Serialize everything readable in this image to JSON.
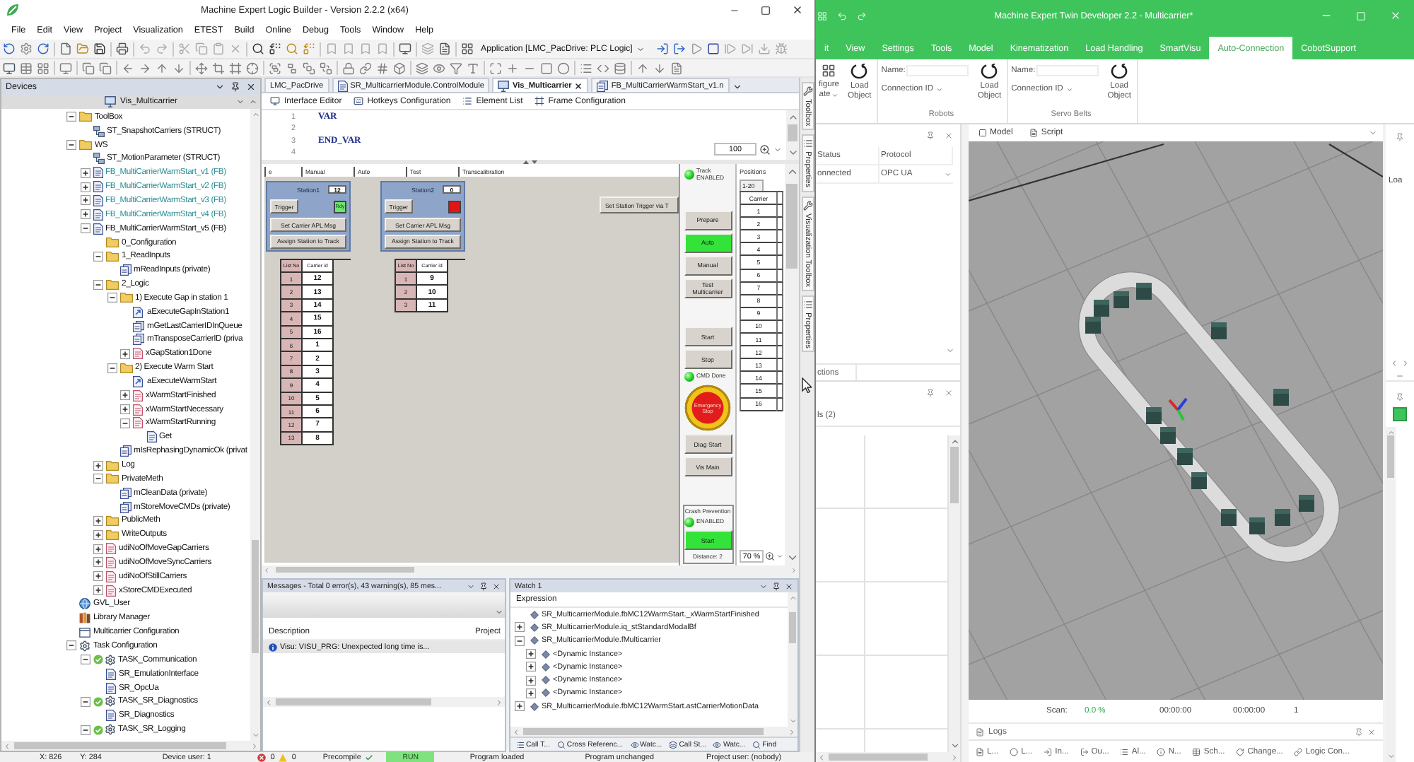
{
  "logic_builder": {
    "title": "Machine Expert Logic Builder - Version 2.2.2 (x64)",
    "menu": [
      "File",
      "Edit",
      "View",
      "Project",
      "Visualization",
      "ETEST",
      "Build",
      "Online",
      "Debug",
      "Tools",
      "Window",
      "Help"
    ],
    "application_selector": "Application [LMC_PacDrive: PLC Logic]",
    "devices": {
      "title": "Devices",
      "current_item": "Vis_Multicarrier",
      "tree": [
        {
          "label": "ToolBox",
          "kind": "folder",
          "expanded": true,
          "children": [
            {
              "label": "ST_SnapshotCarriers (STRUCT)",
              "kind": "struct"
            }
          ]
        },
        {
          "label": "WS",
          "kind": "folder",
          "expanded": true,
          "children": [
            {
              "label": "ST_MotionParameter (STRUCT)",
              "kind": "struct",
              "excluded": false
            },
            {
              "label": "FB_MultiCarrierWarmStart_v1 (FB)",
              "kind": "pou",
              "expanded": false,
              "excluded": true
            },
            {
              "label": "FB_MultiCarrierWarmStart_v2 (FB)",
              "kind": "pou",
              "expanded": false,
              "excluded": true
            },
            {
              "label": "FB_MultiCarrierWarmStart_v3 (FB)",
              "kind": "pou",
              "expanded": false,
              "excluded": true
            },
            {
              "label": "FB_MultiCarrierWarmStart_v4 (FB)",
              "kind": "pou",
              "expanded": false,
              "excluded": true
            },
            {
              "label": "FB_MultiCarrierWarmStart_v5 (FB)",
              "kind": "pou",
              "expanded": true,
              "excluded": false,
              "children": [
                {
                  "label": "0_Configuration",
                  "kind": "folder"
                },
                {
                  "label": "1_ReadInputs",
                  "kind": "folder",
                  "expanded": true,
                  "children": [
                    {
                      "label": "mReadInputs (private)",
                      "kind": "method"
                    }
                  ]
                },
                {
                  "label": "2_Logic",
                  "kind": "folder",
                  "expanded": true,
                  "children": [
                    {
                      "label": "1) Execute Gap in station 1",
                      "kind": "folder",
                      "expanded": true,
                      "children": [
                        {
                          "label": "aExecuteGapInStation1",
                          "kind": "action"
                        },
                        {
                          "label": "mGetLastCarrierIDInQueue",
                          "kind": "method"
                        },
                        {
                          "label": "mTransposeCarrierID (priva",
                          "kind": "method"
                        },
                        {
                          "label": "xGapStation1Done",
                          "kind": "property",
                          "expanded": false
                        }
                      ]
                    },
                    {
                      "label": "2) Execute Warm Start",
                      "kind": "folder",
                      "expanded": true,
                      "children": [
                        {
                          "label": "aExecuteWarmStart",
                          "kind": "action"
                        },
                        {
                          "label": "xWarmStartFinished",
                          "kind": "property",
                          "expanded": false
                        },
                        {
                          "label": "xWarmStartNecessary",
                          "kind": "property",
                          "expanded": false
                        },
                        {
                          "label": "xWarmStartRunning",
                          "kind": "property",
                          "expanded": true,
                          "children": [
                            {
                              "label": "Get",
                              "kind": "accessor"
                            }
                          ]
                        }
                      ]
                    },
                    {
                      "label": "mIsRephasingDynamicOk (privat",
                      "kind": "method"
                    }
                  ]
                },
                {
                  "label": "Log",
                  "kind": "folder",
                  "expanded": false
                },
                {
                  "label": "PrivateMeth",
                  "kind": "folder",
                  "expanded": true,
                  "children": [
                    {
                      "label": "mCleanData (private)",
                      "kind": "method"
                    },
                    {
                      "label": "mStoreMoveCMDs (private)",
                      "kind": "method"
                    }
                  ]
                },
                {
                  "label": "PublicMeth",
                  "kind": "folder",
                  "expanded": false
                },
                {
                  "label": "WriteOutputs",
                  "kind": "folder",
                  "expanded": false
                },
                {
                  "label": "udiNoOfMoveGapCarriers",
                  "kind": "property",
                  "expanded": false
                },
                {
                  "label": "udiNoOfMoveSyncCarriers",
                  "kind": "property",
                  "expanded": false
                },
                {
                  "label": "udiNoOfStillCarriers",
                  "kind": "property",
                  "expanded": false
                },
                {
                  "label": "xStoreCMDExecuted",
                  "kind": "property",
                  "expanded": false
                }
              ]
            }
          ]
        },
        {
          "label": "GVL_User",
          "kind": "gvl"
        },
        {
          "label": "Library Manager",
          "kind": "library"
        },
        {
          "label": "Multicarrier Configuration",
          "kind": "config"
        },
        {
          "label": "Task Configuration",
          "kind": "task_config",
          "expanded": true,
          "children": [
            {
              "label": "TASK_Communication",
              "kind": "task",
              "expanded": true,
              "children": [
                {
                  "label": "SR_EmulationInterface",
                  "kind": "program"
                },
                {
                  "label": "SR_OpcUa",
                  "kind": "program"
                }
              ]
            },
            {
              "label": "TASK_SR_Diagnostics",
              "kind": "task",
              "expanded": true,
              "children": [
                {
                  "label": "SR_Diagnostics",
                  "kind": "program"
                }
              ]
            },
            {
              "label": "TASK_SR_Logging",
              "kind": "task",
              "expanded": true
            }
          ]
        }
      ]
    },
    "editor_tabs": [
      {
        "label": "LMC_PacDrive",
        "kind": "plain",
        "selected": false
      },
      {
        "label": "SR_MulticarrierModule.ControlModule",
        "kind": "program",
        "selected": false
      },
      {
        "label": "Vis_Multicarrier",
        "kind": "visu",
        "selected": true
      },
      {
        "label": "FB_MultiCarrierWarmStart_v1.n",
        "kind": "method",
        "selected": false
      }
    ],
    "editor_subtabs": [
      "Interface Editor",
      "Hotkeys Configuration",
      "Element List",
      "Frame Configuration"
    ],
    "code_lines": [
      {
        "number": "1",
        "text": "VAR"
      },
      {
        "number": "2"
      },
      {
        "number": "3",
        "text": "END_VAR"
      },
      {
        "number": "4"
      }
    ],
    "code_zoom": "100",
    "visu": {
      "tabs": [
        "e",
        "Manual",
        "Auto",
        "Test",
        "Transcalibration"
      ],
      "stations": [
        {
          "title": "Station1",
          "value": "12",
          "trigger": "Trigger",
          "ready": true,
          "ready_label": "Rdy",
          "buttons": [
            "Set Carrier APL Msg",
            "Assign Station to Track"
          ],
          "columns": [
            "List No",
            "Carrier id"
          ],
          "rows": [
            [
              "1",
              "12"
            ],
            [
              "2",
              "13"
            ],
            [
              "3",
              "14"
            ],
            [
              "4",
              "15"
            ],
            [
              "5",
              "16"
            ],
            [
              "6",
              "1"
            ],
            [
              "7",
              "2"
            ],
            [
              "8",
              "3"
            ],
            [
              "9",
              "4"
            ],
            [
              "10",
              "5"
            ],
            [
              "11",
              "6"
            ],
            [
              "12",
              "7"
            ],
            [
              "13",
              "8"
            ]
          ]
        },
        {
          "title": "Station2",
          "value": "0",
          "trigger": "Trigger",
          "ready": false,
          "buttons": [
            "Set Carrier APL Msg",
            "Assign Station to Track"
          ],
          "columns": [
            "List No",
            "Carrier id"
          ],
          "rows": [
            [
              "1",
              "9"
            ],
            [
              "2",
              "10"
            ],
            [
              "3",
              "11"
            ]
          ]
        }
      ],
      "station_trigger_button": "Set Station Trigger via T",
      "control_groups": [
        {
          "items": [
            {
              "kind": "led",
              "label": "Track ENABLED",
              "on": true
            }
          ]
        },
        {
          "items": [
            {
              "kind": "button",
              "label": "Prepare",
              "active": false
            },
            {
              "kind": "button",
              "label": "Auto",
              "active": true
            },
            {
              "kind": "button",
              "label": "Manual",
              "active": false
            },
            {
              "kind": "button",
              "label": "Test Multicarrier",
              "active": false
            }
          ]
        },
        {
          "items": [
            {
              "kind": "button",
              "label": "Start",
              "active": false
            },
            {
              "kind": "button",
              "label": "Stop",
              "active": false
            },
            {
              "kind": "led",
              "label": "CMD Done",
              "on": true
            },
            {
              "kind": "estop",
              "label": "Emergency Stop"
            },
            {
              "kind": "button",
              "label": "Diag Start",
              "active": false
            },
            {
              "kind": "button",
              "label": "Vis Main",
              "active": false
            }
          ]
        }
      ],
      "crash_prevention": {
        "title": "Crash Prevention",
        "status": "ENABLED",
        "on": true,
        "button": "Start",
        "active": true,
        "distance": "Distance: 2"
      },
      "positions": {
        "title": "Positions",
        "page": "1-20",
        "column": "Carrier",
        "rows": [
          "1",
          "2",
          "3",
          "4",
          "5",
          "6",
          "7",
          "8",
          "9",
          "10",
          "11",
          "12",
          "13",
          "14",
          "15",
          "16"
        ]
      },
      "zoom": "70 %"
    },
    "messages": {
      "title": "Messages - Total 0 error(s), 43 warning(s), 85 mes...",
      "columns": [
        "Description",
        "Project"
      ],
      "rows": [
        {
          "kind": "info",
          "text": "Visu: VISU_PRG: Unexpected long time is..."
        }
      ]
    },
    "watch": {
      "title": "Watch 1",
      "column": "Expression",
      "rows": [
        {
          "text": "SR_MulticarrierModule.fbMC12WarmStart._xWarmStartFinished"
        },
        {
          "text": "SR_MulticarrierModule.iq_stStandardModalBf",
          "expanded": false
        },
        {
          "text": "SR_MulticarrierModule.fMulticarrier",
          "expanded": true,
          "children": [
            {
              "text": "<Dynamic Instance>",
              "expanded": false
            },
            {
              "text": "<Dynamic Instance>",
              "expanded": false
            },
            {
              "text": "<Dynamic Instance>",
              "expanded": false
            },
            {
              "text": "<Dynamic Instance>",
              "expanded": false
            }
          ]
        },
        {
          "text": "SR_MulticarrierModule.fbMC12WarmStart.astCarrierMotionData",
          "expanded": false
        }
      ]
    },
    "bottom_tabs": [
      "Call T...",
      "Cross Referenc...",
      "Watc...",
      "Call St...",
      "Watc...",
      "Find"
    ],
    "side_tabs": [
      {
        "label": "Toolbox",
        "kind": "toolbox"
      },
      {
        "label": "Properties",
        "kind": "properties"
      },
      {
        "label": "Visualization Toolbox",
        "kind": "toolbox"
      },
      {
        "label": "Properties",
        "kind": "properties"
      }
    ],
    "status_bar": {
      "x": "X: 826",
      "y": "Y: 284",
      "device_user": "Device user: 1",
      "errors": "0",
      "warnings": "0",
      "precompile": "Precompile",
      "run_state": "RUN",
      "program_state": "Program loaded",
      "change_state": "Program unchanged",
      "project_user": "Project user: (nobody)"
    }
  },
  "twin_developer": {
    "title": "Machine Expert Twin Developer 2.2 - Multicarrier*",
    "ribbon_tabs": [
      {
        "label": "it",
        "selected": false
      },
      {
        "label": "View",
        "selected": false
      },
      {
        "label": "Settings",
        "selected": false
      },
      {
        "label": "Tools",
        "selected": false
      },
      {
        "label": "Model",
        "selected": false
      },
      {
        "label": "Kinematization",
        "selected": false
      },
      {
        "label": "Load Handling",
        "selected": false
      },
      {
        "label": "SmartVisu",
        "selected": false
      },
      {
        "label": "Auto-Connection",
        "selected": true
      },
      {
        "label": "CobotSupport",
        "selected": false
      }
    ],
    "ribbon_groups": [
      {
        "items": [
          {
            "kind": "configure",
            "lines": [
              "figure",
              "ate"
            ]
          },
          {
            "kind": "load",
            "lines": [
              "Load",
              "Object"
            ]
          }
        ]
      },
      {
        "title": "Robots",
        "items": [
          {
            "kind": "fields",
            "name_label": "Name:",
            "connection_label": "Connection ID"
          },
          {
            "kind": "load",
            "lines": [
              "Load",
              "Object"
            ]
          }
        ]
      },
      {
        "title": "Servo Belts",
        "items": [
          {
            "kind": "fields",
            "name_label": "Name:",
            "connection_label": "Connection ID"
          },
          {
            "kind": "load",
            "lines": [
              "Load",
              "Object"
            ]
          }
        ]
      }
    ],
    "connection_table": {
      "columns": [
        "Status",
        "Protocol"
      ],
      "rows": [
        [
          "onnected",
          "OPC UA"
        ]
      ]
    },
    "connections_tab": "ctions",
    "signals_title": "ls (2)",
    "view_tabs": [
      "Model",
      "Script"
    ],
    "scan": {
      "label": "Scan:",
      "value": "0.0 %",
      "elapsed": "00:00:00",
      "remaining": "00:00:00",
      "count": "1"
    },
    "logs_title": "Logs",
    "logs_tabs": [
      "L...",
      "L...",
      "In...",
      "Ou...",
      "Al...",
      "N...",
      "Sch...",
      "Change...",
      "Logic Con..."
    ],
    "side_label": "Loa"
  }
}
